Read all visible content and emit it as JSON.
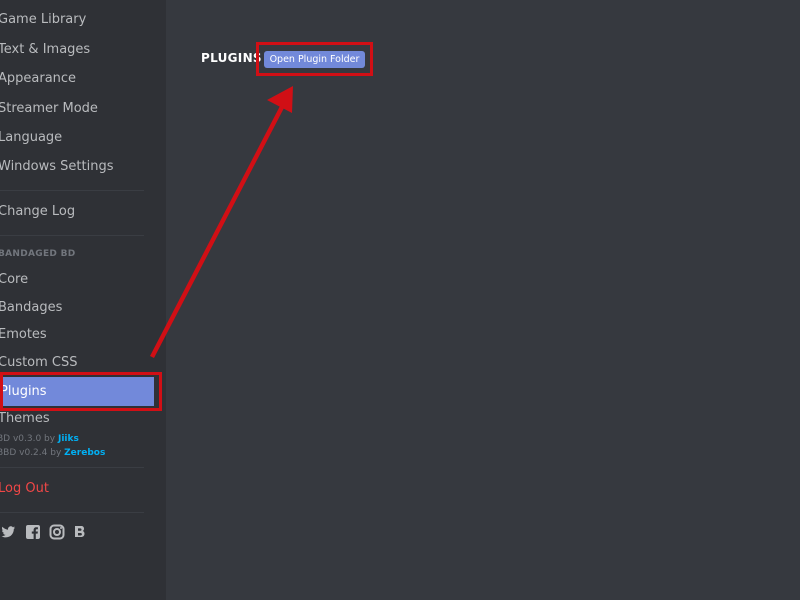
{
  "sidebar": {
    "items_top": [
      {
        "label": "Game Library"
      },
      {
        "label": "Text & Images"
      },
      {
        "label": "Appearance"
      },
      {
        "label": "Streamer Mode"
      },
      {
        "label": "Language"
      },
      {
        "label": "Windows Settings"
      }
    ],
    "changelog_label": "Change Log",
    "section_header": "BANDAGED BD",
    "bd_items": [
      {
        "label": "Core"
      },
      {
        "label": "Bandages"
      },
      {
        "label": "Emotes"
      },
      {
        "label": "Custom CSS"
      },
      {
        "label": "Plugins",
        "selected": true
      },
      {
        "label": "Themes"
      }
    ],
    "credits": [
      {
        "version": "BD v0.3.0 by",
        "author": "Jiiks"
      },
      {
        "version": "BBD v0.2.4 by",
        "author": "Zerebos"
      }
    ],
    "logout_label": "Log Out",
    "social_icons": [
      "twitter-icon",
      "facebook-icon",
      "instagram-icon",
      "bandaged-bd-icon"
    ]
  },
  "main": {
    "title": "PLUGINS",
    "open_folder_label": "Open Plugin Folder"
  },
  "colors": {
    "background": "#36393f",
    "sidebar": "#2f3136",
    "accent": "#7289da",
    "highlight": "#d10f15",
    "danger": "#f04747",
    "link": "#00b0f4"
  }
}
